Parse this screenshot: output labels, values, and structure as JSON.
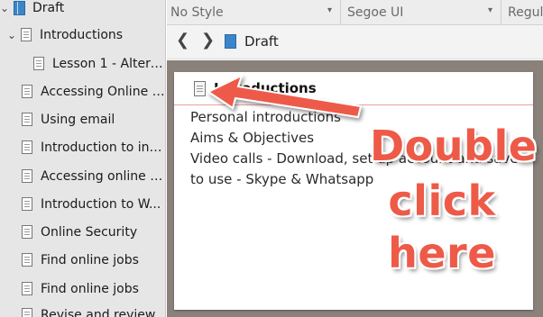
{
  "binder": {
    "root": {
      "label": "Draft",
      "chevron": "chevron-down-icon"
    },
    "items": [
      {
        "label": "Introductions",
        "expanded": true
      },
      {
        "label": "Lesson 1 - Altern..."
      },
      {
        "label": "Accessing Online T..."
      },
      {
        "label": "Using email"
      },
      {
        "label": "Introduction to int..."
      },
      {
        "label": "Accessing online t..."
      },
      {
        "label": "Introduction to W..."
      },
      {
        "label": "Online Security"
      },
      {
        "label": "Find online jobs"
      },
      {
        "label": "Find online jobs"
      },
      {
        "label": "Revise and review"
      }
    ]
  },
  "format_bar": {
    "style": "No Style",
    "font": "Segoe UI",
    "weight": "Regula"
  },
  "editor_header": {
    "back_icon": "chevron-left-icon",
    "forward_icon": "chevron-right-icon",
    "breadcrumb": "Draft"
  },
  "card": {
    "title": "Introductions",
    "synopsis": [
      "Personal introductions",
      "Aims & Objectives",
      "Video calls - Download, set up account and save",
      "to use - Skype & Whatsapp"
    ]
  },
  "annotation": {
    "lines": [
      "Double",
      "click",
      "here"
    ],
    "color": "#ee5a48"
  },
  "colors": {
    "binder_bg": "#e6e6e6",
    "corkboard_bg": "#8a817b",
    "draft_icon": "#3b86c9",
    "card_divider": "#e7a3a3"
  }
}
